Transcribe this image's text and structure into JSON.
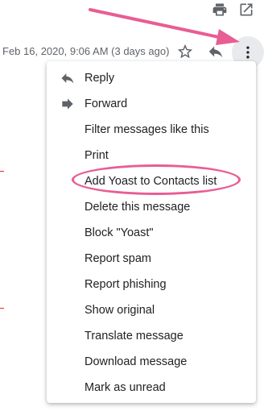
{
  "header": {
    "print_icon": "print-icon",
    "open_icon": "open-in-new-icon"
  },
  "message": {
    "date": "Feb 16, 2020, 9:06 AM (3 days ago)",
    "star_icon": "star-outline-icon",
    "reply_icon": "reply-icon",
    "more_icon": "more-vertical-icon"
  },
  "menu": {
    "items": [
      {
        "label": "Reply",
        "icon": "reply-icon"
      },
      {
        "label": "Forward",
        "icon": "forward-icon"
      },
      {
        "label": "Filter messages like this"
      },
      {
        "label": "Print"
      },
      {
        "label": "Add Yoast to Contacts list"
      },
      {
        "label": "Delete this message"
      },
      {
        "label": "Block \"Yoast\""
      },
      {
        "label": "Report spam"
      },
      {
        "label": "Report phishing"
      },
      {
        "label": "Show original"
      },
      {
        "label": "Translate message"
      },
      {
        "label": "Download message"
      },
      {
        "label": "Mark as unread"
      }
    ]
  },
  "colors": {
    "annotation": "#e85d93",
    "more_button_bg": "#e8eaed",
    "text": "#202124",
    "muted": "#5f6368"
  }
}
